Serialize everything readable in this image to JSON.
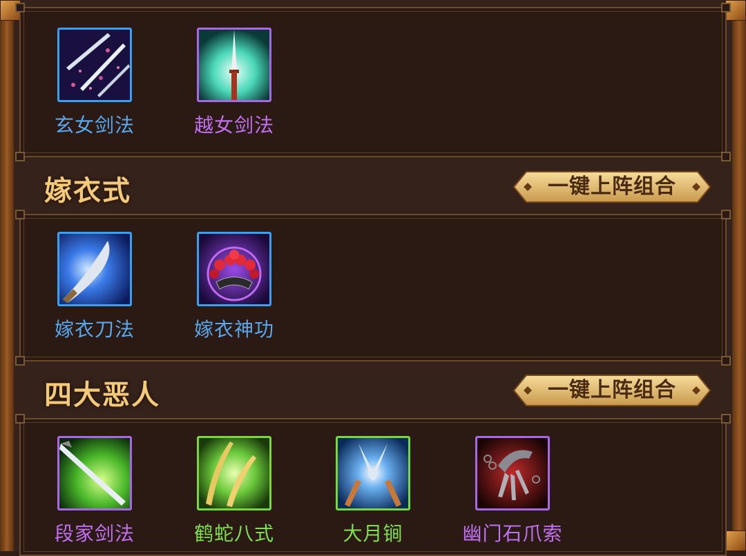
{
  "sections": [
    {
      "title": "",
      "button": "",
      "skills": [
        {
          "name": "玄女剑法",
          "name_color": "#58a8f0",
          "border_color": "#3aa0f0",
          "icon": "twin-blades-petals-icon"
        },
        {
          "name": "越女剑法",
          "name_color": "#c070f0",
          "border_color": "#a868e8",
          "icon": "sword-radiance-icon"
        }
      ]
    },
    {
      "title": "嫁衣式",
      "button": "一键上阵组合",
      "skills": [
        {
          "name": "嫁衣刀法",
          "name_color": "#58a8f0",
          "border_color": "#3aa0f0",
          "icon": "curved-saber-icon"
        },
        {
          "name": "嫁衣神功",
          "name_color": "#58a8f0",
          "border_color": "#3aa0f0",
          "icon": "bridal-crown-icon"
        }
      ]
    },
    {
      "title": "四大恶人",
      "button": "一键上阵组合",
      "skills": [
        {
          "name": "段家剑法",
          "name_color": "#c070f0",
          "border_color": "#a868e8",
          "icon": "green-sword-slash-icon"
        },
        {
          "name": "鹤蛇八式",
          "name_color": "#7ee04a",
          "border_color": "#78d83c",
          "icon": "twin-golden-blades-icon"
        },
        {
          "name": "大月锏",
          "name_color": "#7ee04a",
          "border_color": "#78d83c",
          "icon": "crossed-shears-icon"
        },
        {
          "name": "幽门石爪索",
          "name_color": "#c070f0",
          "border_color": "#a868e8",
          "icon": "chain-claw-icon"
        }
      ]
    }
  ]
}
